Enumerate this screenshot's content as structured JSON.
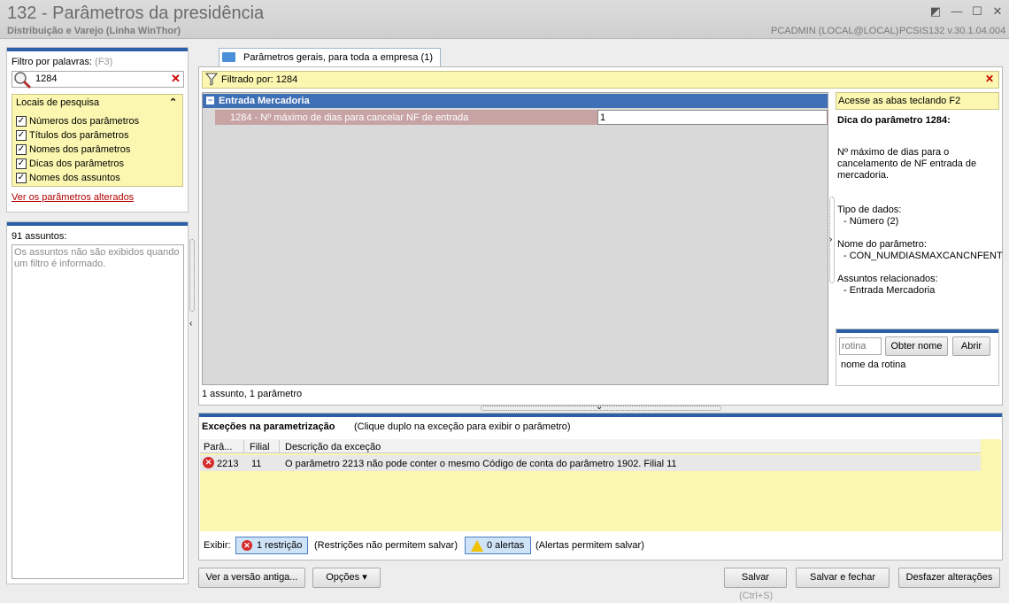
{
  "window": {
    "title": "132 - Parâmetros da presidência",
    "subtitle": "Distribuição e Varejo (Linha WinThor)",
    "user": "PCADMIN (LOCAL@LOCAL)",
    "version": "PCSIS132  v.30.1.04.004",
    "buttons": {
      "restore": "◩",
      "minimize": "—",
      "maximize": "☐",
      "close": "✕"
    }
  },
  "filter": {
    "label": "Filtro por palavras:",
    "shortcut": "(F3)",
    "search_value": "1284",
    "clear_icon": "✕",
    "locais_title": "Locais de pesquisa",
    "collapse_icon": "⌃",
    "options": [
      {
        "label": "Números dos parâmetros",
        "checked": true
      },
      {
        "label": "Títulos dos parâmetros",
        "checked": true
      },
      {
        "label": "Nomes dos parâmetros",
        "checked": true
      },
      {
        "label": "Dicas dos parâmetros",
        "checked": true
      },
      {
        "label": "Nomes dos assuntos",
        "checked": true
      }
    ],
    "link_alterados": "Ver os parâmetros alterados"
  },
  "assuntos": {
    "count": "91 assuntos:",
    "hint": "Os assuntos não são exibidos quando um filtro é informado."
  },
  "tab": {
    "label": "Parâmetros gerais, para toda a empresa  (1)"
  },
  "filter_bar": {
    "text": "Filtrado por: 1284",
    "close_icon": "✕"
  },
  "grid": {
    "group_label": "Entrada Mercadoria",
    "group_toggle": "−",
    "param_label": "1284 - Nº máximo de dias para cancelar NF de entrada",
    "param_value": "1",
    "status": "1 assunto, 1 parâmetro"
  },
  "hint": {
    "bar_text": "Acesse as abas teclando F2",
    "title": "Dica do parâmetro 1284:",
    "description": "Nº máximo de dias para o cancelamento de NF entrada de mercadoria.",
    "tipo_label": "Tipo de dados:",
    "tipo_value": "- Número (2)",
    "nome_label": "Nome do parâmetro:",
    "nome_value": "- CON_NUMDIASMAXCANCNFENT",
    "assuntos_label": "Assuntos relacionados:",
    "assuntos_value": "- Entrada Mercadoria"
  },
  "rotina": {
    "placeholder": "rotina",
    "obter_label": "Obter nome",
    "abrir_label": "Abrir",
    "name_label": "nome da rotina"
  },
  "exceptions": {
    "title": "Exceções na parametrização",
    "hint": "(Clique duplo na exceção para exibir o parâmetro)",
    "columns": [
      "Parâ...",
      "Filial",
      "Descrição da exceção"
    ],
    "rows": [
      {
        "param": "2213",
        "filial": "11",
        "description": "O parâmetro 2213 não pode conter o mesmo Código de conta do parâmetro 1902. Filial 11"
      }
    ],
    "exibir_label": "Exibir:",
    "restricao_label": "1 restrição",
    "restricao_note": "(Restrições não permitem salvar)",
    "alertas_label": "0 alertas",
    "alertas_note": "(Alertas permitem salvar)"
  },
  "footer": {
    "versao_label": "Ver a versão antiga...",
    "opcoes_label": "Opções ▾",
    "salvar_label": "Salvar",
    "salvar_shortcut": "(Ctrl+S)",
    "salvar_fechar_label": "Salvar e fechar",
    "desfazer_label": "Desfazer alterações"
  }
}
